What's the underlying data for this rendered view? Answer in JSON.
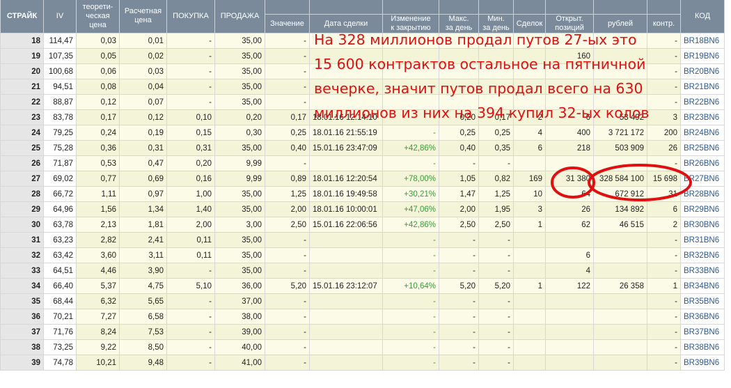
{
  "header": {
    "strike": "СТРАЙК",
    "iv": "IV",
    "theo": [
      "теорети-",
      "ческая",
      "цена"
    ],
    "calc": [
      "Расчетная",
      "цена"
    ],
    "buy": "ПОКУПКА",
    "sell": "ПРОДАЖА",
    "value": "Значение",
    "date": "Дата сделки",
    "change": [
      "Изменение",
      "к закрытию"
    ],
    "max": [
      "Макс.",
      "за день"
    ],
    "min": [
      "Мин.",
      "за день"
    ],
    "deals": "Сделок",
    "oi": [
      "Открыт.",
      "позиций"
    ],
    "rub": "рублей",
    "contr": "контр.",
    "code": "КОД"
  },
  "rows": [
    {
      "strike": "18",
      "iv": "114,47",
      "theo": "0,03",
      "calc": "0,01",
      "buy": "-",
      "sell": "35,00",
      "value": "-",
      "date": "",
      "change": "",
      "max": "",
      "min": "",
      "deals": "",
      "oi": "",
      "rub": "",
      "contr": "-",
      "code": "BR18BN6"
    },
    {
      "strike": "19",
      "iv": "107,35",
      "theo": "0,05",
      "calc": "0,02",
      "buy": "-",
      "sell": "35,00",
      "value": "-",
      "date": "",
      "change": "",
      "max": "",
      "min": "",
      "deals": "",
      "oi": "160",
      "rub": "",
      "contr": "-",
      "code": "BR19BN6"
    },
    {
      "strike": "20",
      "iv": "100,68",
      "theo": "0,06",
      "calc": "0,03",
      "buy": "-",
      "sell": "35,00",
      "value": "-",
      "date": "",
      "change": "",
      "max": "",
      "min": "",
      "deals": "",
      "oi": "",
      "rub": "",
      "contr": "-",
      "code": "BR20BN6"
    },
    {
      "strike": "21",
      "iv": "94,51",
      "theo": "0,08",
      "calc": "0,04",
      "buy": "-",
      "sell": "35,00",
      "value": "-",
      "date": "",
      "change": "",
      "max": "",
      "min": "",
      "deals": "",
      "oi": "",
      "rub": "",
      "contr": "-",
      "code": "BR21BN6"
    },
    {
      "strike": "22",
      "iv": "88,87",
      "theo": "0,12",
      "calc": "0,07",
      "buy": "-",
      "sell": "35,00",
      "value": "-",
      "date": "",
      "change": "",
      "max": "",
      "min": "",
      "deals": "",
      "oi": "",
      "rub": "",
      "contr": "-",
      "code": "BR22BN6"
    },
    {
      "strike": "23",
      "iv": "83,78",
      "theo": "0,17",
      "calc": "0,12",
      "buy": "0,10",
      "sell": "0,20",
      "value": "0,17",
      "date": "18.01.16 12:14:10",
      "change": "-",
      "max": "0,20",
      "min": "0,17",
      "deals": "2",
      "oi": "6",
      "rub": "53 492",
      "contr": "3",
      "code": "BR23BN6"
    },
    {
      "strike": "24",
      "iv": "79,25",
      "theo": "0,24",
      "calc": "0,19",
      "buy": "0,15",
      "sell": "0,30",
      "value": "0,25",
      "date": "18.01.16 21:55:19",
      "change": "-",
      "max": "0,25",
      "min": "0,25",
      "deals": "4",
      "oi": "400",
      "rub": "3 721 172",
      "contr": "200",
      "code": "BR24BN6"
    },
    {
      "strike": "25",
      "iv": "75,28",
      "theo": "0,36",
      "calc": "0,31",
      "buy": "0,31",
      "sell": "35,00",
      "value": "0,40",
      "date": "15.01.16 23:47:09",
      "change": "+42,86%",
      "max": "0,40",
      "min": "0,35",
      "deals": "6",
      "oi": "218",
      "rub": "503 909",
      "contr": "26",
      "code": "BR25BN6"
    },
    {
      "strike": "26",
      "iv": "71,87",
      "theo": "0,53",
      "calc": "0,47",
      "buy": "0,20",
      "sell": "9,99",
      "value": "-",
      "date": "",
      "change": "-",
      "max": "-",
      "min": "-",
      "deals": "",
      "oi": "",
      "rub": "",
      "contr": "-",
      "code": "BR26BN6"
    },
    {
      "strike": "27",
      "iv": "69,02",
      "theo": "0,77",
      "calc": "0,69",
      "buy": "0,16",
      "sell": "9,99",
      "value": "0,89",
      "date": "18.01.16 12:20:54",
      "change": "+78,00%",
      "max": "1,05",
      "min": "0,82",
      "deals": "169",
      "oi": "31 380",
      "rub": "328 584 100",
      "contr": "15 698",
      "code": "BR27BN6"
    },
    {
      "strike": "28",
      "iv": "66,72",
      "theo": "1,11",
      "calc": "0,97",
      "buy": "1,00",
      "sell": "35,00",
      "value": "1,25",
      "date": "18.01.16 19:49:58",
      "change": "+30,21%",
      "max": "1,47",
      "min": "1,25",
      "deals": "10",
      "oi": "64",
      "rub": "672 912",
      "contr": "31",
      "code": "BR28BN6"
    },
    {
      "strike": "29",
      "iv": "64,96",
      "theo": "1,56",
      "calc": "1,34",
      "buy": "1,40",
      "sell": "35,00",
      "value": "2,00",
      "date": "18.01.16 10:00:01",
      "change": "+47,06%",
      "max": "2,00",
      "min": "1,95",
      "deals": "3",
      "oi": "26",
      "rub": "134 892",
      "contr": "6",
      "code": "BR29BN6"
    },
    {
      "strike": "30",
      "iv": "63,78",
      "theo": "2,13",
      "calc": "1,81",
      "buy": "2,00",
      "sell": "3,00",
      "value": "2,50",
      "date": "15.01.16 22:06:56",
      "change": "+42,86%",
      "max": "2,50",
      "min": "2,50",
      "deals": "1",
      "oi": "62",
      "rub": "46 515",
      "contr": "2",
      "code": "BR30BN6"
    },
    {
      "strike": "31",
      "iv": "63,23",
      "theo": "2,82",
      "calc": "2,41",
      "buy": "0,11",
      "sell": "35,00",
      "value": "-",
      "date": "",
      "change": "-",
      "max": "-",
      "min": "-",
      "deals": "",
      "oi": "",
      "rub": "",
      "contr": "-",
      "code": "BR31BN6"
    },
    {
      "strike": "32",
      "iv": "63,42",
      "theo": "3,60",
      "calc": "3,11",
      "buy": "0,11",
      "sell": "35,00",
      "value": "-",
      "date": "",
      "change": "-",
      "max": "-",
      "min": "-",
      "deals": "",
      "oi": "6",
      "rub": "",
      "contr": "-",
      "code": "BR32BN6"
    },
    {
      "strike": "33",
      "iv": "64,51",
      "theo": "4,46",
      "calc": "3,90",
      "buy": "-",
      "sell": "35,00",
      "value": "-",
      "date": "",
      "change": "-",
      "max": "-",
      "min": "-",
      "deals": "",
      "oi": "4",
      "rub": "",
      "contr": "-",
      "code": "BR33BN6"
    },
    {
      "strike": "34",
      "iv": "66,40",
      "theo": "5,37",
      "calc": "4,75",
      "buy": "5,10",
      "sell": "36,00",
      "value": "5,20",
      "date": "15.01.16 23:12:07",
      "change": "+10,64%",
      "max": "5,20",
      "min": "5,20",
      "deals": "1",
      "oi": "122",
      "rub": "26 358",
      "contr": "1",
      "code": "BR34BN6"
    },
    {
      "strike": "35",
      "iv": "68,44",
      "theo": "6,32",
      "calc": "5,65",
      "buy": "-",
      "sell": "37,00",
      "value": "-",
      "date": "",
      "change": "-",
      "max": "-",
      "min": "-",
      "deals": "",
      "oi": "",
      "rub": "",
      "contr": "-",
      "code": "BR35BN6"
    },
    {
      "strike": "36",
      "iv": "70,21",
      "theo": "7,27",
      "calc": "6,58",
      "buy": "-",
      "sell": "38,00",
      "value": "-",
      "date": "",
      "change": "-",
      "max": "-",
      "min": "-",
      "deals": "",
      "oi": "",
      "rub": "",
      "contr": "-",
      "code": "BR36BN6"
    },
    {
      "strike": "37",
      "iv": "71,76",
      "theo": "8,24",
      "calc": "7,53",
      "buy": "-",
      "sell": "39,00",
      "value": "-",
      "date": "",
      "change": "-",
      "max": "-",
      "min": "-",
      "deals": "",
      "oi": "",
      "rub": "",
      "contr": "-",
      "code": "BR37BN6"
    },
    {
      "strike": "38",
      "iv": "73,25",
      "theo": "9,22",
      "calc": "8,50",
      "buy": "-",
      "sell": "40,00",
      "value": "-",
      "date": "",
      "change": "-",
      "max": "-",
      "min": "-",
      "deals": "",
      "oi": "",
      "rub": "",
      "contr": "-",
      "code": "BR38BN6"
    },
    {
      "strike": "39",
      "iv": "74,78",
      "theo": "10,21",
      "calc": "9,48",
      "buy": "-",
      "sell": "41,00",
      "value": "-",
      "date": "",
      "change": "-",
      "max": "-",
      "min": "-",
      "deals": "",
      "oi": "",
      "rub": "",
      "contr": "-",
      "code": "BR39BN6"
    }
  ],
  "annotation": {
    "lines": [
      "На 328 миллионов продал путов 27-ых это",
      "15 600 контрактов остальное на пятничной",
      "вечерке, значит путов продал всего на 630",
      "миллионов из них на 394 купил 32-ых колов"
    ],
    "color": "#e01010"
  }
}
